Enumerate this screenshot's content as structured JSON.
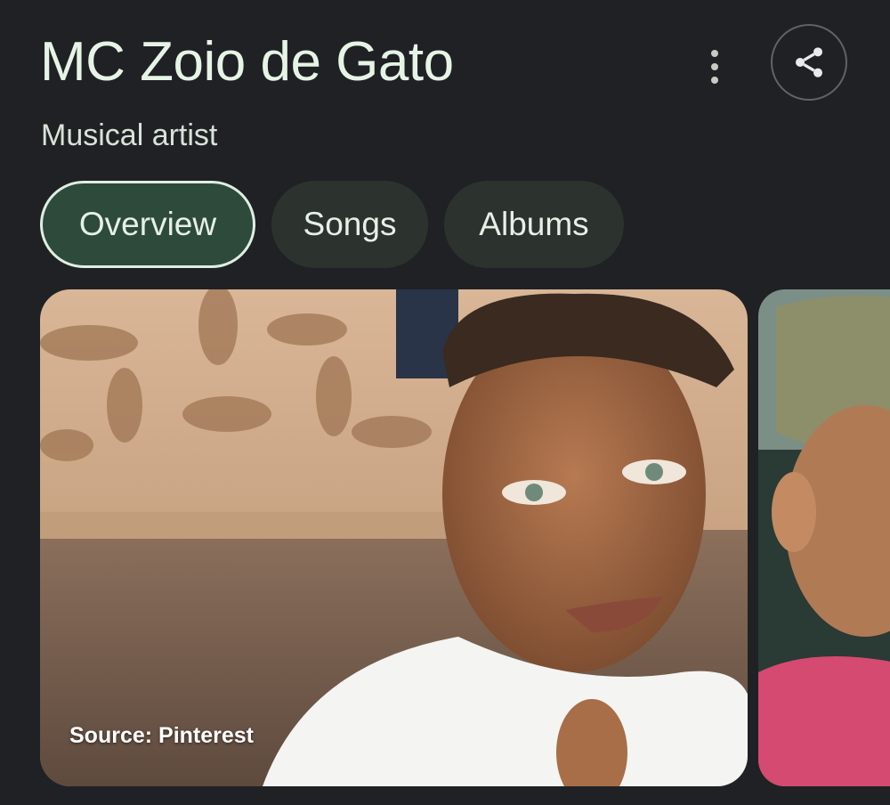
{
  "header": {
    "title": "MC Zoio de Gato",
    "subtitle": "Musical artist"
  },
  "actions": {
    "more_icon": "more-vertical-icon",
    "share_icon": "share-icon"
  },
  "tabs": [
    {
      "label": "Overview",
      "active": true
    },
    {
      "label": "Songs",
      "active": false
    },
    {
      "label": "Albums",
      "active": false
    }
  ],
  "images": [
    {
      "source_caption": "Source: Pinterest"
    },
    {}
  ],
  "colors": {
    "background": "#202124",
    "chip_active": "#2d4a3a",
    "chip_inactive": "#2c332e",
    "text": "#e6f4e6"
  }
}
